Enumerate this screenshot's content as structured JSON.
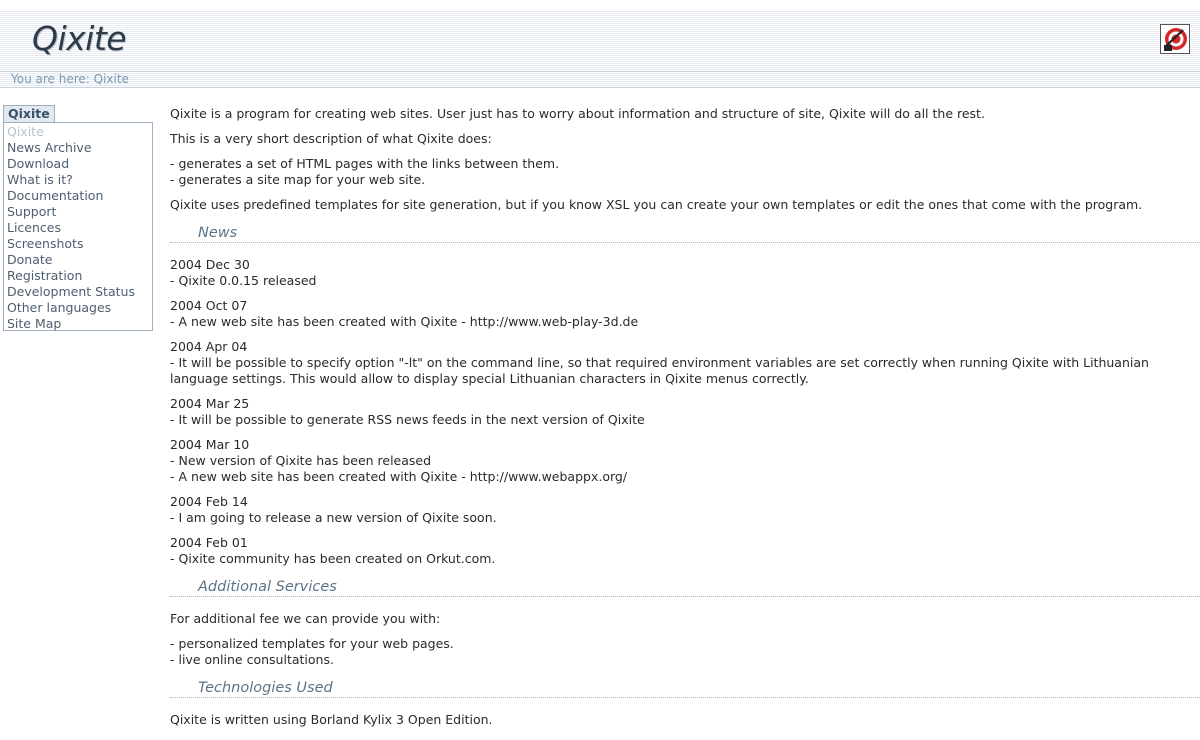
{
  "header": {
    "logo": "Qixite"
  },
  "breadcrumb": {
    "text": "You are here: Qixite"
  },
  "sidebar": {
    "title": "Qixite",
    "items": [
      {
        "label": "Qixite",
        "current": true
      },
      {
        "label": "News Archive"
      },
      {
        "label": "Download"
      },
      {
        "label": "What is it?"
      },
      {
        "label": "Documentation"
      },
      {
        "label": "Support"
      },
      {
        "label": "Licences"
      },
      {
        "label": "Screenshots"
      },
      {
        "label": "Donate"
      },
      {
        "label": "Registration"
      },
      {
        "label": "Development Status"
      },
      {
        "label": "Other languages"
      },
      {
        "label": "Site Map"
      }
    ]
  },
  "intro": {
    "p1": "Qixite is a program for creating web sites. User just has to worry about information and structure of site, Qixite will do all the rest.",
    "p2": "This is a very short description of what Qixite does:",
    "list": [
      "- generates a set of HTML pages with the links between them.",
      "- generates a site map for your web site."
    ],
    "p3": "Qixite uses predefined templates for site generation, but if you know XSL you can create your own templates or edit the ones that come with the program."
  },
  "news": {
    "heading": "News",
    "items": [
      {
        "date": "2004 Dec 30",
        "lines": [
          "- Qixite 0.0.15 released"
        ]
      },
      {
        "date": "2004 Oct 07",
        "lines": [
          "- A new web site has been created with Qixite - http://www.web-play-3d.de"
        ]
      },
      {
        "date": "2004 Apr 04",
        "lines": [
          "- It will be possible to specify option \"-lt\" on the command line, so that required environment variables are set correctly when running Qixite with Lithuanian language settings. This would allow to display special Lithuanian characters in Qixite menus correctly."
        ]
      },
      {
        "date": "2004 Mar 25",
        "lines": [
          "- It will be possible to generate RSS news feeds in the next version of Qixite"
        ]
      },
      {
        "date": "2004 Mar 10",
        "lines": [
          "- New version of Qixite has been released",
          "- A new web site has been created with Qixite - http://www.webappx.org/"
        ]
      },
      {
        "date": "2004 Feb 14",
        "lines": [
          "- I am going to release a new version of Qixite soon."
        ]
      },
      {
        "date": "2004 Feb 01",
        "lines": [
          "- Qixite community has been created on Orkut.com."
        ]
      }
    ]
  },
  "services": {
    "heading": "Additional Services",
    "p1": "For additional fee we can provide you with:",
    "list": [
      "- personalized templates for your web pages.",
      "- live online consultations."
    ]
  },
  "technologies": {
    "heading": "Technologies Used",
    "p1": "Qixite is written using Borland Kylix 3 Open Edition."
  },
  "icons": {
    "corner": "qixite-badge-icon"
  },
  "colors": {
    "link": "#4d5e70",
    "section_heading": "#5d7488",
    "breadcrumb": "#7d9ab4"
  }
}
